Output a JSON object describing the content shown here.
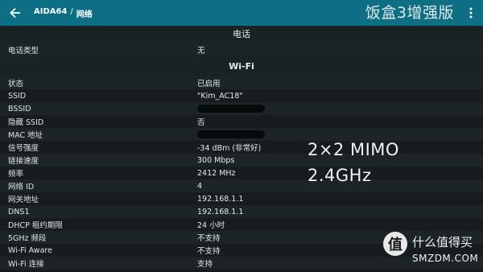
{
  "appbar": {
    "title_app": "AIDA64",
    "title_sep": "/",
    "title_page": "网络",
    "watermark": "饭盒3增强版"
  },
  "sections": {
    "phone": {
      "header": "电话",
      "rows": [
        {
          "label": "电话类型",
          "value": "无"
        }
      ]
    },
    "wifi": {
      "header": "Wi-Fi",
      "rows": [
        {
          "label": "状态",
          "value": "已启用"
        },
        {
          "label": "SSID",
          "value": "\"Kim_AC18\""
        },
        {
          "label": "BSSID",
          "value": ""
        },
        {
          "label": "隐藏 SSID",
          "value": "否"
        },
        {
          "label": "MAC 地址",
          "value": ""
        },
        {
          "label": "信号强度",
          "value": "-34 dBm (非常好)"
        },
        {
          "label": "链接速度",
          "value": "300 Mbps"
        },
        {
          "label": "频率",
          "value": "2412 MHz"
        },
        {
          "label": "网络 ID",
          "value": "4"
        },
        {
          "label": "网关地址",
          "value": "192.168.1.1"
        },
        {
          "label": "DNS1",
          "value": "192.168.1.1"
        },
        {
          "label": "DHCP 租约期限",
          "value": "24 小时"
        },
        {
          "label": "5GHz 频段",
          "value": "不支持"
        },
        {
          "label": "Wi-Fi Aware",
          "value": "不支持"
        },
        {
          "label": "Wi-Fi 连接",
          "value": "支持"
        }
      ]
    }
  },
  "overlay": {
    "line1": "2×2 MIMO",
    "line2": "2.4GHz"
  },
  "logo": {
    "glyph": "值",
    "cn": "什么值得买",
    "en": "SMZDM.COM"
  }
}
